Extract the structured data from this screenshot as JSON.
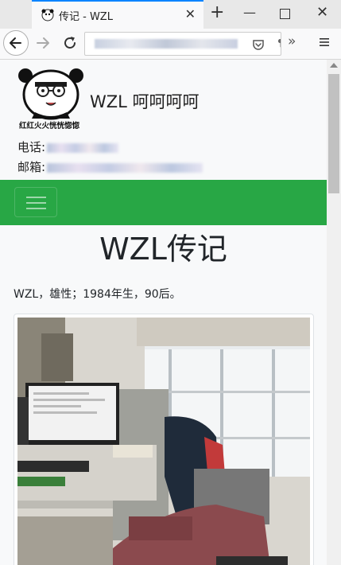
{
  "browser": {
    "tab_title": "传记 - WZL",
    "tab_close": "✕",
    "new_tab": "+",
    "win_min": "—",
    "win_close": "✕",
    "url_overflow": "¶",
    "overflow_menu": "»",
    "icons": [
      "tab-favicon-icon",
      "back-icon",
      "forward-icon",
      "reload-icon",
      "pocket-icon",
      "menu-icon"
    ]
  },
  "site": {
    "title": "WZL 呵呵呵呵",
    "avatar_caption": "红红火火恍恍惚惚",
    "phone_label": "电话:",
    "email_label": "邮箱:"
  },
  "page": {
    "heading": "WZL传记",
    "intro": "WZL，雄性；1984年生，90后。"
  },
  "colors": {
    "navbar_green": "#28a745",
    "tab_accent": "#0a84ff"
  }
}
